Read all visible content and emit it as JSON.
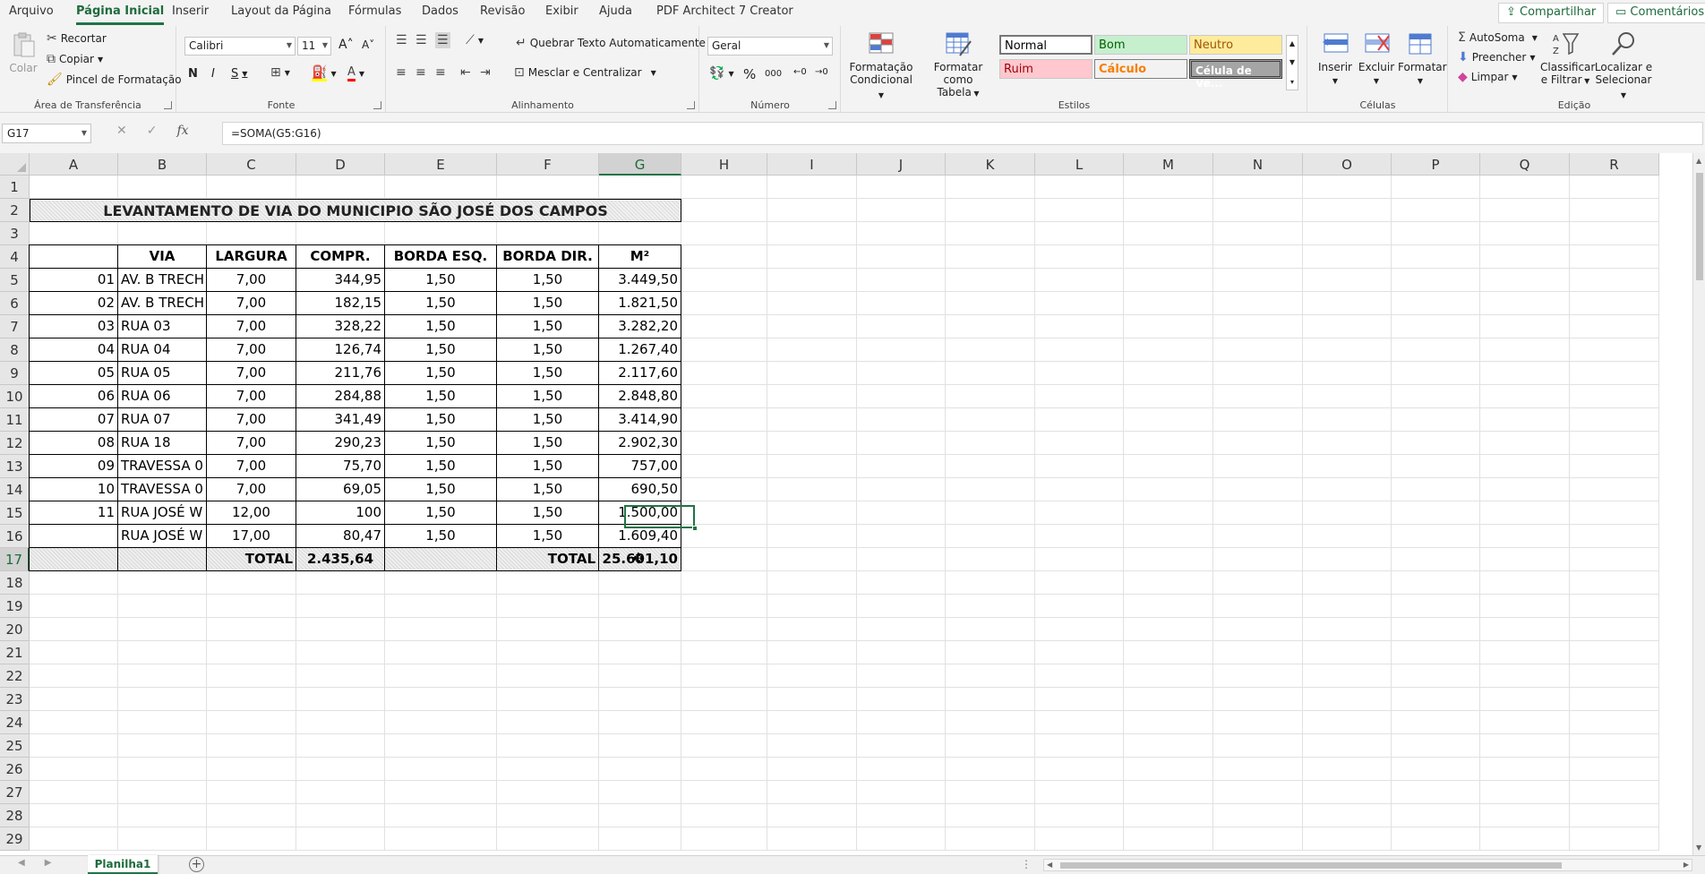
{
  "menu": {
    "tabs": [
      "Arquivo",
      "Página Inicial",
      "Inserir",
      "Layout da Página",
      "Fórmulas",
      "Dados",
      "Revisão",
      "Exibir",
      "Ajuda",
      "PDF Architect 7 Creator"
    ],
    "share": "Compartilhar",
    "comments": "Comentários"
  },
  "ribbon": {
    "clipboard": {
      "label": "Área de Transferência",
      "paste": "Colar",
      "cut": "Recortar",
      "copy": "Copiar",
      "format_painter": "Pincel de Formatação"
    },
    "font": {
      "label": "Fonte",
      "name": "Calibri",
      "size": "11",
      "bold": "N",
      "italic": "I",
      "underline": "S",
      "font_color_letter": "A"
    },
    "alignment": {
      "label": "Alinhamento",
      "wrap": "Quebrar Texto Automaticamente",
      "merge": "Mesclar e Centralizar"
    },
    "number": {
      "label": "Número",
      "format": "Geral",
      "percent": "%",
      "thousands": "000"
    },
    "styles": {
      "label": "Estilos",
      "conditional_line1": "Formatação",
      "conditional_line2": "Condicional",
      "table_line1": "Formatar como",
      "table_line2": "Tabela",
      "normal": "Normal",
      "good": "Bom",
      "neutral": "Neutro",
      "bad": "Ruim",
      "calc": "Cálculo",
      "check": "Célula de Ve..."
    },
    "cells": {
      "label": "Células",
      "insert": "Inserir",
      "delete": "Excluir",
      "format": "Formatar"
    },
    "editing": {
      "label": "Edição",
      "autosum": "AutoSoma",
      "fill": "Preencher",
      "clear": "Limpar",
      "sort_line1": "Classificar",
      "sort_line2": "e Filtrar",
      "find_line1": "Localizar e",
      "find_line2": "Selecionar"
    }
  },
  "formula_bar": {
    "name_box": "G17",
    "fx": "fx",
    "formula": "=SOMA(G5:G16)"
  },
  "columns": [
    "A",
    "B",
    "C",
    "D",
    "E",
    "F",
    "G",
    "H",
    "I",
    "J",
    "K",
    "L",
    "M",
    "N",
    "O",
    "P",
    "Q",
    "R"
  ],
  "rows": [
    "1",
    "2",
    "3",
    "4",
    "5",
    "6",
    "7",
    "8",
    "9",
    "10",
    "11",
    "12",
    "13",
    "14",
    "15",
    "16",
    "17",
    "18",
    "19",
    "20",
    "21",
    "22",
    "23",
    "24",
    "25",
    "26",
    "27",
    "28",
    "29"
  ],
  "sheet": {
    "title": "LEVANTAMENTO DE VIA DO MUNICIPIO SÃO JOSÉ DOS CAMPOS",
    "headers": [
      "",
      "VIA",
      "LARGURA",
      "COMPR.",
      "BORDA ESQ.",
      "BORDA DIR.",
      "M²"
    ],
    "data": [
      [
        "01",
        "AV. B TRECH",
        "7,00",
        "344,95",
        "1,50",
        "1,50",
        "3.449,50"
      ],
      [
        "02",
        "AV. B TRECH",
        "7,00",
        "182,15",
        "1,50",
        "1,50",
        "1.821,50"
      ],
      [
        "03",
        "RUA 03",
        "7,00",
        "328,22",
        "1,50",
        "1,50",
        "3.282,20"
      ],
      [
        "04",
        "RUA 04",
        "7,00",
        "126,74",
        "1,50",
        "1,50",
        "1.267,40"
      ],
      [
        "05",
        "RUA 05",
        "7,00",
        "211,76",
        "1,50",
        "1,50",
        "2.117,60"
      ],
      [
        "06",
        "RUA 06",
        "7,00",
        "284,88",
        "1,50",
        "1,50",
        "2.848,80"
      ],
      [
        "07",
        "RUA 07",
        "7,00",
        "341,49",
        "1,50",
        "1,50",
        "3.414,90"
      ],
      [
        "08",
        "RUA 18",
        "7,00",
        "290,23",
        "1,50",
        "1,50",
        "2.902,30"
      ],
      [
        "09",
        "TRAVESSA 0",
        "7,00",
        "75,70",
        "1,50",
        "1,50",
        "757,00"
      ],
      [
        "10",
        "TRAVESSA 0",
        "7,00",
        "69,05",
        "1,50",
        "1,50",
        "690,50"
      ],
      [
        "11",
        "RUA JOSÉ W",
        "12,00",
        "100",
        "1,50",
        "1,50",
        "1.500,00"
      ],
      [
        "",
        "RUA JOSÉ W",
        "17,00",
        "80,47",
        "1,50",
        "1,50",
        "1.609,40"
      ]
    ],
    "total_label": "TOTAL",
    "total_compr": "2.435,64",
    "total_label2": "TOTAL",
    "total_m2": "25.601,10"
  },
  "sheet_tabs": {
    "active": "Planilha1"
  }
}
